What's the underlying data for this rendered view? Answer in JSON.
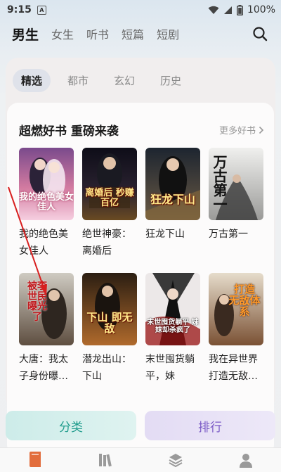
{
  "status_bar": {
    "time": "9:15",
    "notif_letter": "A",
    "battery": "100%"
  },
  "top_tabs": [
    "男生",
    "女生",
    "听书",
    "短篇",
    "短剧"
  ],
  "sub_tabs": [
    "精选",
    "都市",
    "玄幻",
    "历史"
  ],
  "section": {
    "title": "超燃好书 重磅来袭",
    "more": "更多好书"
  },
  "books": [
    {
      "title": "我的绝色美女佳人",
      "cover_text": "我的绝色美女佳人",
      "colors": [
        "#c96a8a",
        "#f3c1d4"
      ]
    },
    {
      "title": "绝世神豪：离婚后",
      "cover_text": "离婚后 秒赚百亿",
      "colors": [
        "#151421",
        "#3c2d20"
      ]
    },
    {
      "title": "狂龙下山",
      "cover_text": "狂龙下山",
      "colors": [
        "#24303d",
        "#5b5043"
      ]
    },
    {
      "title": "万古第一",
      "cover_text": "万古第一",
      "colors": [
        "#e6e6e3",
        "#a8a8a6"
      ]
    },
    {
      "title": "大唐：我太子身份曝光了",
      "cover_text": "被李世民曝光了",
      "colors": [
        "#b6b2a8",
        "#6b5a4b"
      ]
    },
    {
      "title": "潜龙出山：下山",
      "cover_text": "下山 即无敌",
      "colors": [
        "#3c2a18",
        "#a6622a"
      ]
    },
    {
      "title": "末世囤货躺平，妹",
      "cover_text": "末世囤货躺平 妹妹却杀疯了",
      "colors": [
        "#e9e6e6",
        "#8a1414"
      ]
    },
    {
      "title": "我在异世界打造无敌体系",
      "cover_text": "打造 无敌体系",
      "colors": [
        "#d9cfbf",
        "#8a5a3a"
      ]
    }
  ],
  "bottom_buttons": {
    "category": "分类",
    "ranking": "排行"
  },
  "nav_icons": [
    "bookshelf-icon",
    "library-icon",
    "layers-icon",
    "profile-icon"
  ]
}
